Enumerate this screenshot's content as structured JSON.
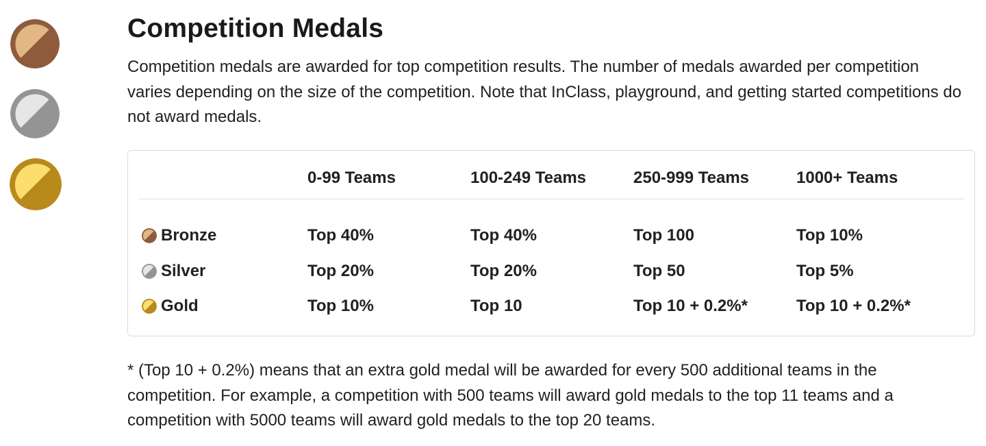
{
  "page": {
    "title": "Competition Medals",
    "intro": "Competition medals are awarded for top competition results. The number of medals awarded per competition varies depending on the size of the competition. Note that InClass, playground, and getting started competitions do not award medals.",
    "footnote": "* (Top 10 + 0.2%) means that an extra gold medal will be awarded for every 500 additional teams in the competition. For example, a competition with 500 teams will award gold medals to the top 11 teams and a competition with 5000 teams will award gold medals to the top 20 teams."
  },
  "medal_colors": {
    "bronze": {
      "light": "#e3b784",
      "dark": "#8e5b3d",
      "ring": "#8e5b3d"
    },
    "silver": {
      "light": "#e6e6e6",
      "dark": "#949494",
      "ring": "#949494"
    },
    "gold": {
      "light": "#fddd6d",
      "dark": "#b88a1b",
      "ring": "#b88a1b"
    }
  },
  "table": {
    "headers": [
      "",
      "0-99 Teams",
      "100-249 Teams",
      "250-999 Teams",
      "1000+ Teams"
    ],
    "rows": [
      {
        "medal": "Bronze",
        "icon": "bronze-medal-icon",
        "values": [
          "Top 40%",
          "Top 40%",
          "Top 100",
          "Top 10%"
        ]
      },
      {
        "medal": "Silver",
        "icon": "silver-medal-icon",
        "values": [
          "Top 20%",
          "Top 20%",
          "Top 50",
          "Top 5%"
        ]
      },
      {
        "medal": "Gold",
        "icon": "gold-medal-icon",
        "values": [
          "Top 10%",
          "Top 10",
          "Top 10 + 0.2%*",
          "Top 10 + 0.2%*"
        ]
      }
    ]
  }
}
